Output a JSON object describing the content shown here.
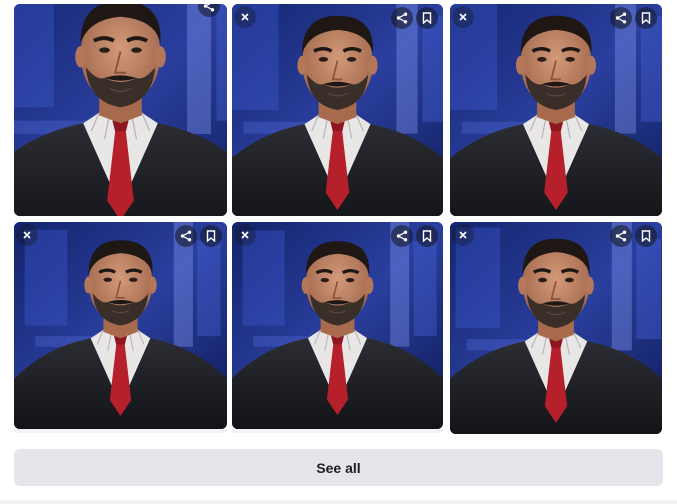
{
  "results": {
    "images": [
      {
        "id": "image-1",
        "has_close": false,
        "has_save": false
      },
      {
        "id": "image-2",
        "has_close": true,
        "has_save": true
      },
      {
        "id": "image-3",
        "has_close": true,
        "has_save": true
      },
      {
        "id": "image-4",
        "has_close": true,
        "has_save": true
      },
      {
        "id": "image-5",
        "has_close": true,
        "has_save": true
      },
      {
        "id": "image-6",
        "has_close": true,
        "has_save": true
      }
    ],
    "tile_icons": {
      "close": "close-icon",
      "share": "share-icon",
      "save": "bookmark-icon"
    },
    "see_all_label": "See all"
  },
  "colors": {
    "button_bg": "#e4e6eb",
    "button_text": "#1c1e21",
    "studio_blue": "#1a2a6e",
    "tie_red": "#b5202a"
  }
}
